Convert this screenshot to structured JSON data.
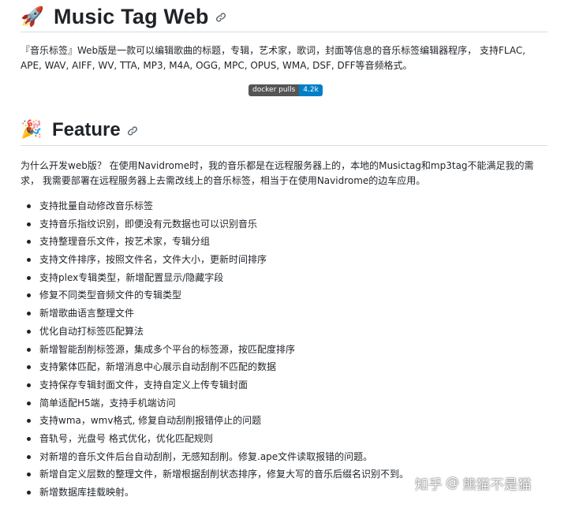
{
  "header": {
    "emoji": "🚀",
    "title": "Music Tag Web"
  },
  "intro": {
    "text": "『音乐标签』Web版是一款可以编辑歌曲的标题，专辑，艺术家，歌词，封面等信息的音乐标签编辑器程序， 支持FLAC, APE, WAV, AIFF, WV, TTA, MP3, M4A, OGG, MPC, OPUS, WMA, DSF, DFF等音频格式。"
  },
  "badge": {
    "label": "docker pulls",
    "value": "4.2k",
    "label_color": "#555555",
    "value_color": "#007ec6"
  },
  "feature": {
    "emoji": "🎉",
    "title": "Feature",
    "why": "为什么开发web版？ 在使用Navidrome时，我的音乐都是在远程服务器上的，本地的Musictag和mp3tag不能满足我的需求， 我需要部署在远程服务器上去需改线上的音乐标签，相当于在使用Navidrome的边车应用。",
    "items": [
      "支持批量自动修改音乐标签",
      "支持音乐指纹识别，即便没有元数据也可以识别音乐",
      "支持整理音乐文件，按艺术家，专辑分组",
      "支持文件排序，按照文件名，文件大小，更新时间排序",
      "支持plex专辑类型，新增配置显示/隐藏字段",
      "修复不同类型音频文件的专辑类型",
      "新增歌曲语言整理文件",
      "优化自动打标签匹配算法",
      "新增智能刮削标签源，集成多个平台的标签源，按匹配度排序",
      "支持繁体匹配，新增消息中心展示自动刮削不匹配的数据",
      "支持保存专辑封面文件，支持自定义上传专辑封面",
      "简单适配H5端，支持手机端访问",
      "支持wma，wmv格式, 修复自动刮削报错停止的问题",
      "音轨号，光盘号 格式优化，优化匹配规则",
      "对新增的音乐文件后台自动刮削，无感知刮削。修复.ape文件读取报错的问题。",
      "新增自定义层数的整理文件，新增根据刮削状态排序，修复大写的音乐后缀名识别不到。",
      "新增数据库挂载映射。"
    ]
  },
  "watermark": {
    "site": "知乎",
    "separator": "@",
    "author": "熊猫不是猫"
  }
}
